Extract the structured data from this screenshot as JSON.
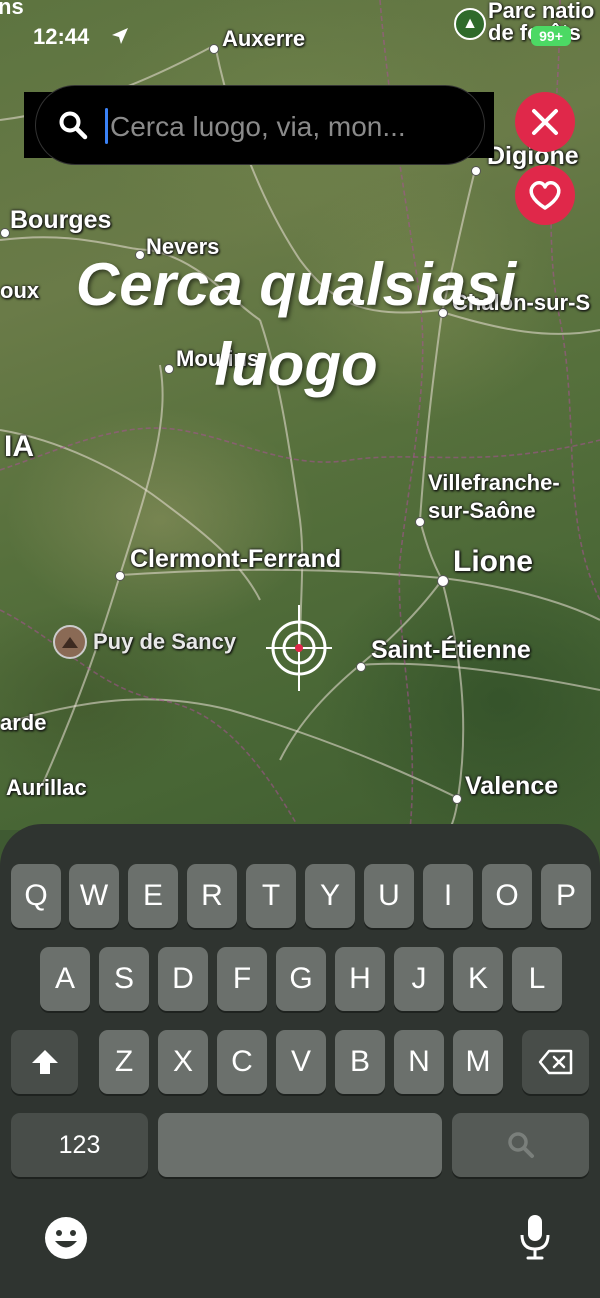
{
  "status_bar": {
    "time": "12:44",
    "location_arrow": "location-arrow-icon",
    "battery": "99+",
    "truncated_label": "ns"
  },
  "map": {
    "park": {
      "label_line1": "Parc natio",
      "label_line2": "de forêts"
    },
    "places": {
      "auxerre": "Auxerre",
      "digione": "Digione",
      "bourges": "Bourges",
      "nevers": "Nevers",
      "chalon": "Chalon-sur-S",
      "oux": "oux",
      "moulins": "Moulins",
      "ia": "IA",
      "villefranche_1": "Villefranche-",
      "villefranche_2": "sur-Saône",
      "clermont": "Clermont-Ferrand",
      "lione": "Lione",
      "puy": "Puy de Sancy",
      "saint_etienne": "Saint-Étienne",
      "arde": "arde",
      "aurillac": "Aurillac",
      "valence": "Valence"
    },
    "headline_line1": "Cerca qualsiasi",
    "headline_line2": "luogo"
  },
  "search": {
    "placeholder": "Cerca luogo, via, mon..."
  },
  "keyboard": {
    "row1": [
      "Q",
      "W",
      "E",
      "R",
      "T",
      "Y",
      "U",
      "I",
      "O",
      "P"
    ],
    "row2": [
      "A",
      "S",
      "D",
      "F",
      "G",
      "H",
      "J",
      "K",
      "L"
    ],
    "row3": [
      "Z",
      "X",
      "C",
      "V",
      "B",
      "N",
      "M"
    ],
    "numbers_label": "123"
  },
  "colors": {
    "accent_red": "#e0284a",
    "caret_blue": "#3b82f6"
  }
}
